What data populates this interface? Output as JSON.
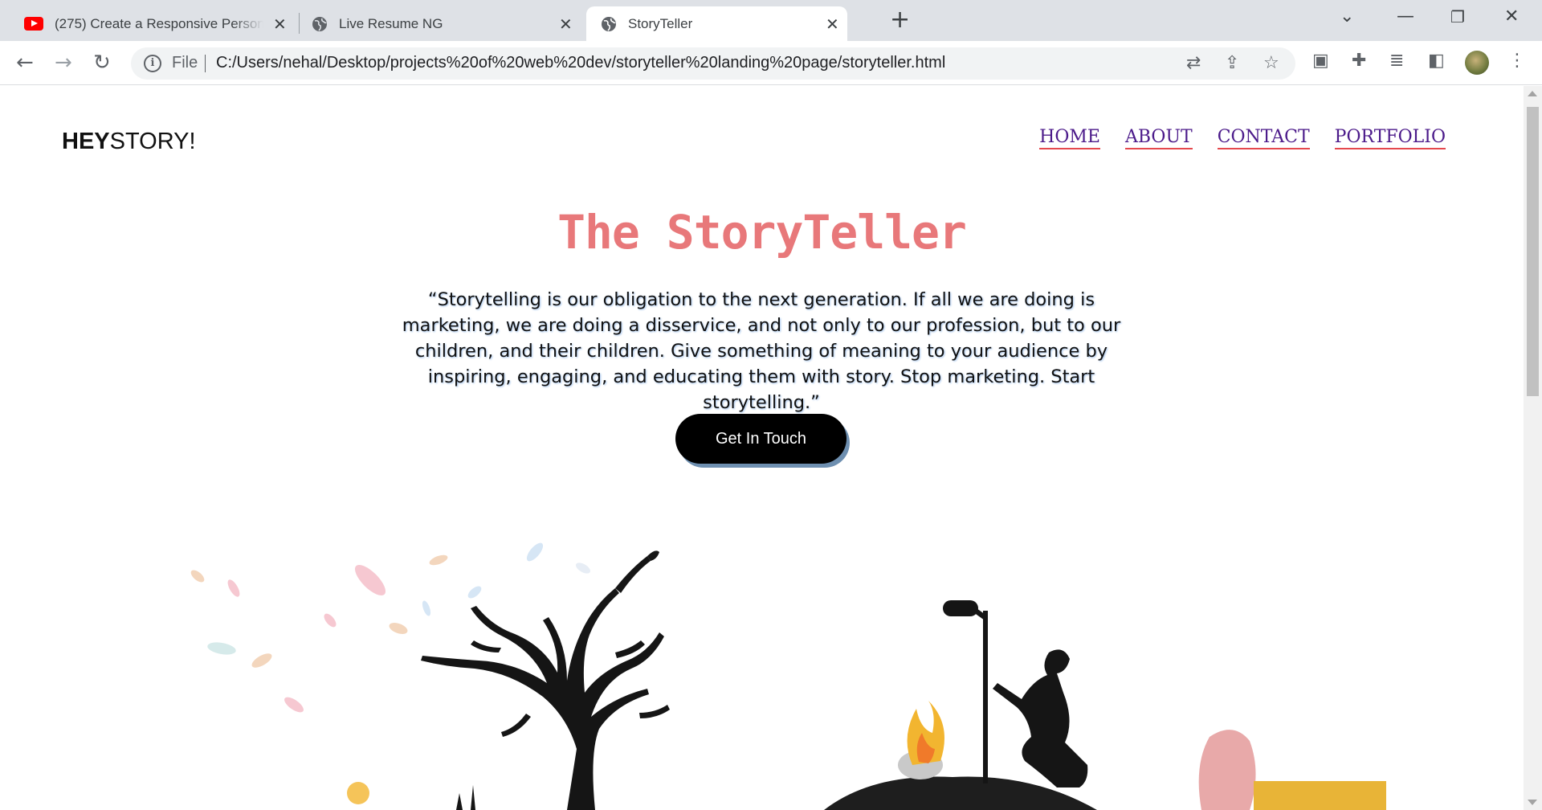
{
  "browser": {
    "tabs": [
      {
        "title": "(275) Create a Responsive Person",
        "icon": "youtube-icon",
        "active": false
      },
      {
        "title": "Live Resume NG",
        "icon": "globe-icon",
        "active": false
      },
      {
        "title": "StoryTeller",
        "icon": "globe-icon",
        "active": true
      }
    ],
    "address": {
      "scheme_label": "File",
      "url": "C:/Users/nehal/Desktop/projects%20of%20web%20dev/storyteller%20landing%20page/storyteller.html"
    }
  },
  "page": {
    "brand": {
      "bold": "HEY",
      "rest": "STORY!"
    },
    "nav": [
      {
        "label": "HOME"
      },
      {
        "label": "ABOUT"
      },
      {
        "label": "CONTACT"
      },
      {
        "label": "PORTFOLIO"
      }
    ],
    "hero": {
      "title": "The StoryTeller",
      "quote": "“Storytelling is our obligation to the next generation. If all we are doing is marketing, we are doing a disservice, and not only to our profession, but to our children, and their children. Give something of meaning to your audience by inspiring, engaging, and educating them with story. Stop marketing. Start storytelling.”",
      "cta_label": "Get In Touch"
    }
  },
  "colors": {
    "title": "#e8787a",
    "nav_link": "#4b1a8a",
    "nav_underline": "#e5484d",
    "cta_bg": "#000000",
    "cta_shadow": "#6e8fb0"
  }
}
